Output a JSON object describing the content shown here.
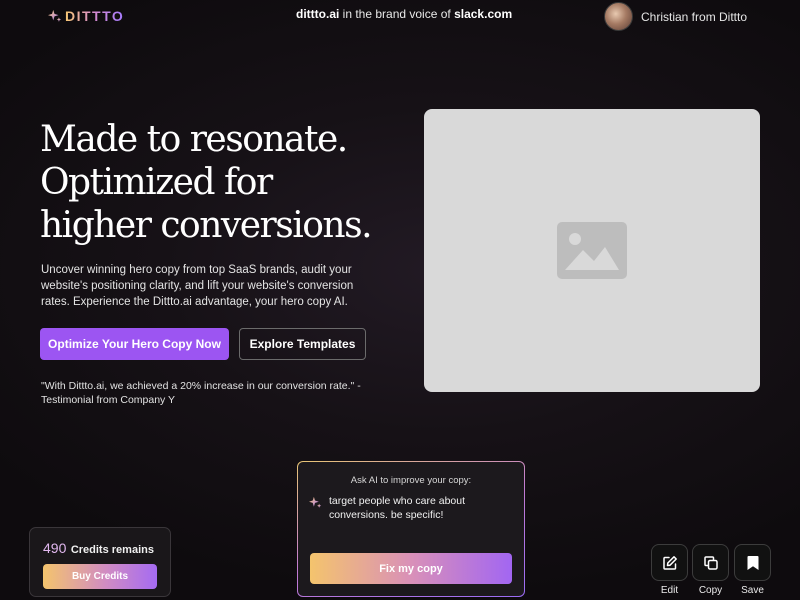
{
  "header": {
    "logo_text": "DITTTO",
    "brand_site": "dittto.ai",
    "brand_mid": " in the brand voice of ",
    "brand_target": "slack.com",
    "user_name": "Christian from Dittto"
  },
  "hero": {
    "title_lines": [
      "Made to resonate.",
      "Optimized for",
      "higher conversions."
    ],
    "description": "Uncover winning hero copy from top SaaS brands, audit your website's positioning clarity, and lift your website's conversion rates. Experience the Dittto.ai advantage, your hero copy AI.",
    "primary_button": "Optimize Your Hero Copy Now",
    "secondary_button": "Explore Templates",
    "testimonial": "\"With Dittto.ai, we achieved a 20% increase in our conversion rate.\" - Testimonial from Company Y"
  },
  "ai_box": {
    "label": "Ask AI to improve your copy:",
    "prompt": "target people who care about conversions. be specific!",
    "button": "Fix my copy"
  },
  "credits": {
    "count": "490",
    "label": "Credits remains",
    "button": "Buy Credits"
  },
  "actions": [
    {
      "label": "Edit",
      "icon": "edit-icon"
    },
    {
      "label": "Copy",
      "icon": "copy-icon"
    },
    {
      "label": "Save",
      "icon": "bookmark-icon"
    }
  ],
  "colors": {
    "accent_purple": "#9c55f2",
    "gradient_gold": "#f4c46d",
    "gradient_violet": "#a266f2",
    "placeholder_gray": "#d9d9d9"
  }
}
